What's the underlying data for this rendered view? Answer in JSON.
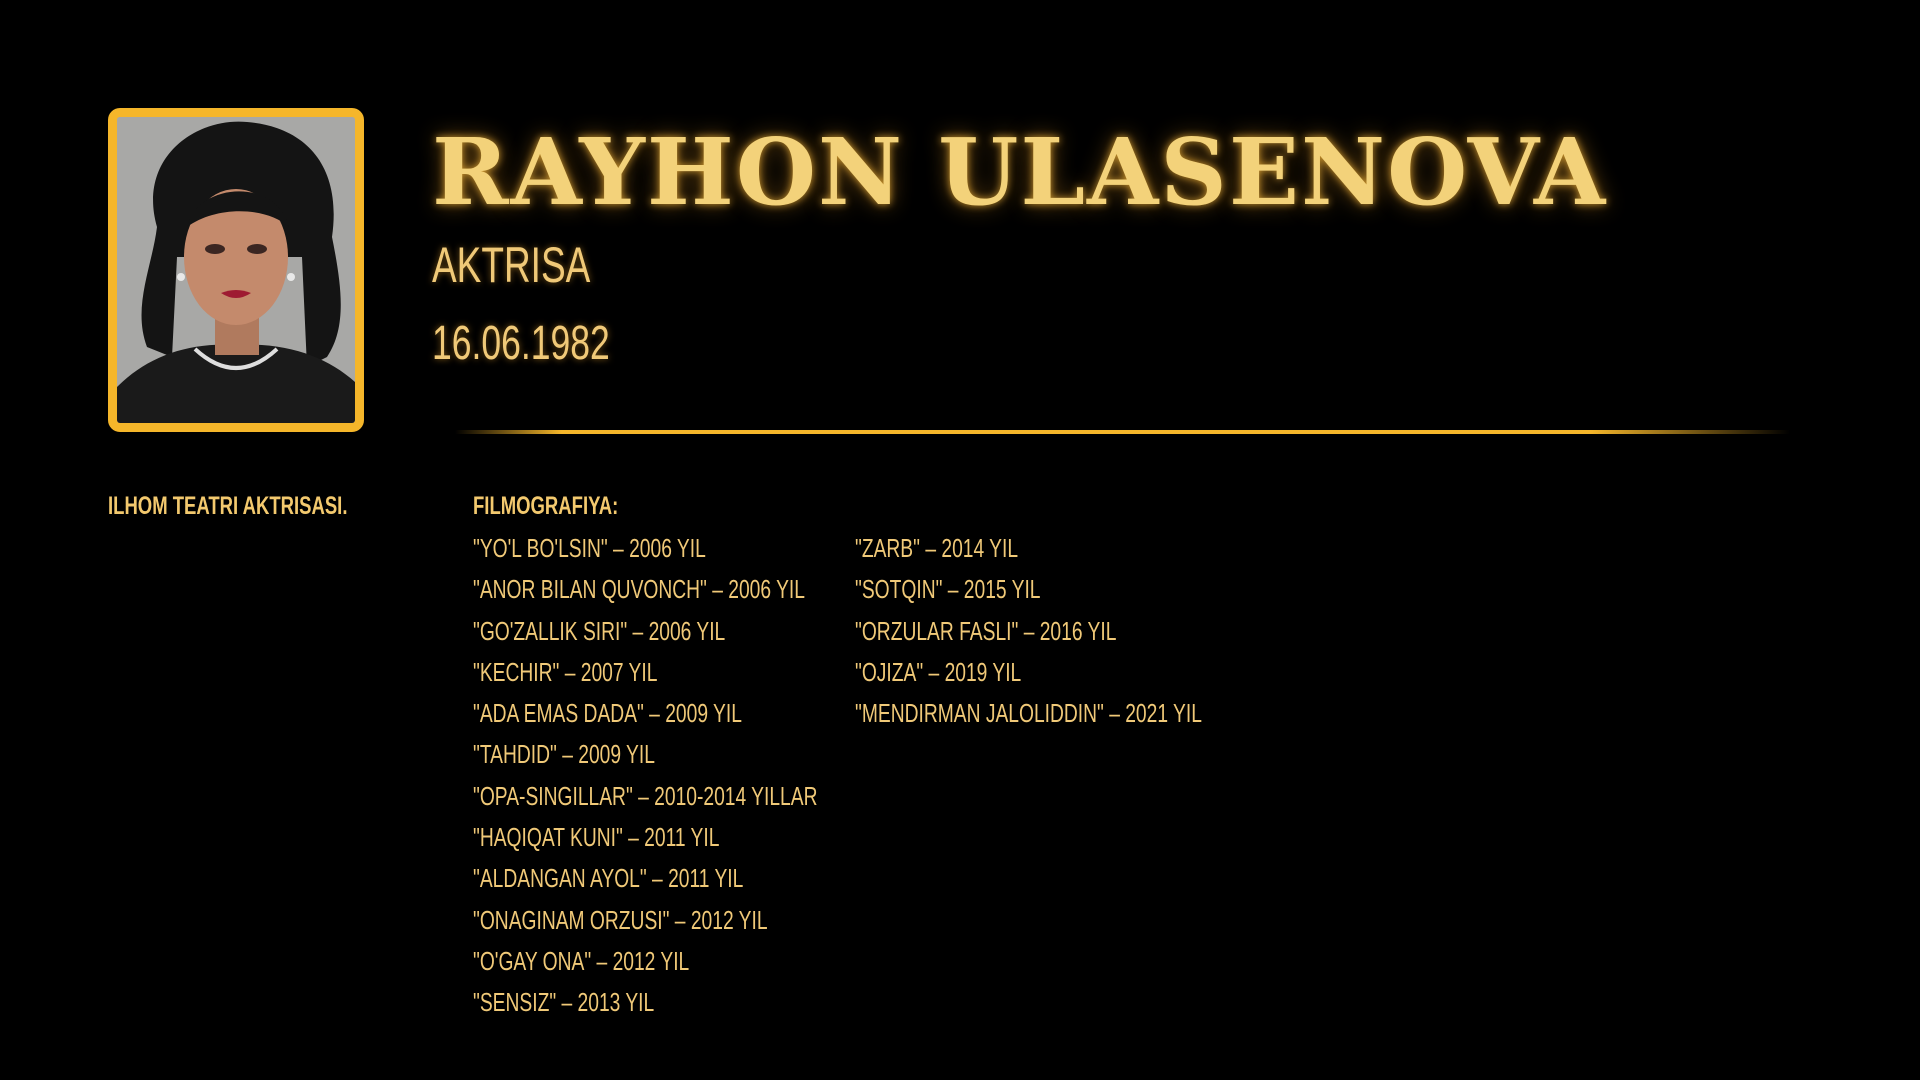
{
  "profile": {
    "name": "RAYHON ULASENOVA",
    "role": "AKTRISA",
    "birth_date": "16.06.1982",
    "about": "ILHOM TEATRI AKTRISASI."
  },
  "filmography": {
    "heading": "FILMOGRAFIYA:",
    "column1": [
      "\"YO'L BO'LSIN\" – 2006 YIL",
      "\"ANOR BILAN QUVONCH\" – 2006 YIL",
      "\"GO'ZALLIK SIRI\" – 2006 YIL",
      "\"KECHIR\" – 2007 YIL",
      "\"ADA EMAS DADA\" – 2009 YIL",
      "\"TAHDID\" – 2009 YIL",
      "\"OPA-SINGILLAR\" – 2010-2014 YILLAR",
      "\"HAQIQAT KUNI\" – 2011 YIL",
      "\"ALDANGAN AYOL\" – 2011 YIL",
      "\"ONAGINAM ORZUSI\" – 2012 YIL",
      "\"O'GAY ONA\" – 2012 YIL",
      "\"SENSIZ\" – 2013 YIL"
    ],
    "column2": [
      "\"ZARB\" – 2014 YIL",
      "\"SOTQIN\" – 2015 YIL",
      "\"ORZULAR FASLI\" – 2016 YIL",
      "\"OJIZA\" – 2019 YIL",
      "\"MENDIRMAN JALOLIDDIN\" – 2021 YIL"
    ]
  },
  "colors": {
    "accent": "#f5b62a",
    "text": "#f0c978",
    "background": "#000000"
  }
}
